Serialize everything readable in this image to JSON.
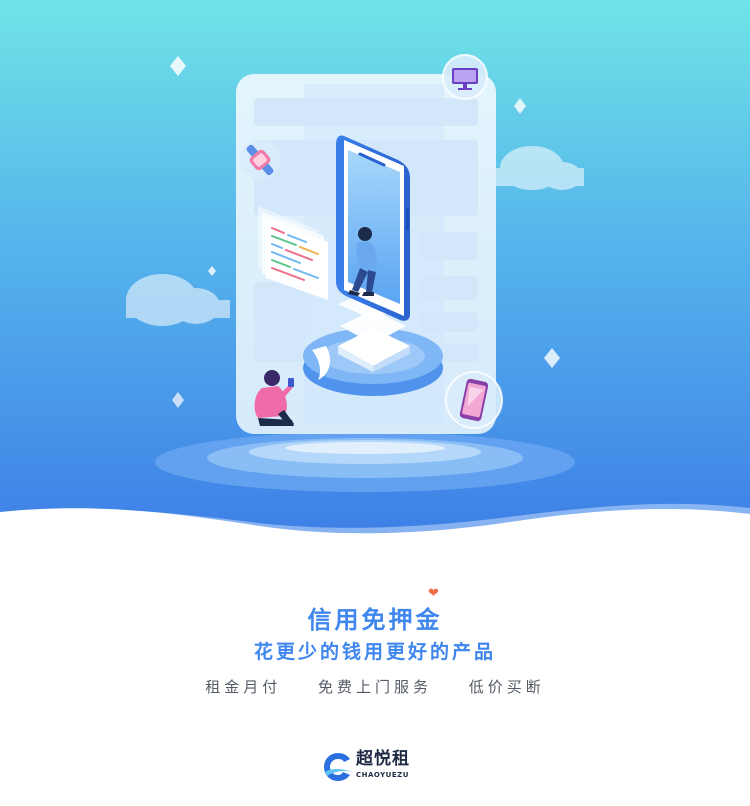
{
  "hero": {
    "icons": [
      "smartwatch-icon",
      "monitor-icon",
      "smartphone-icon"
    ]
  },
  "headline": {
    "title": "信用免押金",
    "subtitle": "花更少的钱用更好的产品"
  },
  "features": [
    "租金月付",
    "免费上门服务",
    "低价买断"
  ],
  "brand": {
    "name": "超悦租",
    "name_en": "CHAOYUEZU"
  },
  "colors": {
    "gradient_top": "#6fe2e6",
    "gradient_bottom": "#3d7fe6",
    "headline": "#3f86ee",
    "feature_text": "#555b66",
    "brand_text": "#1f2a44"
  }
}
